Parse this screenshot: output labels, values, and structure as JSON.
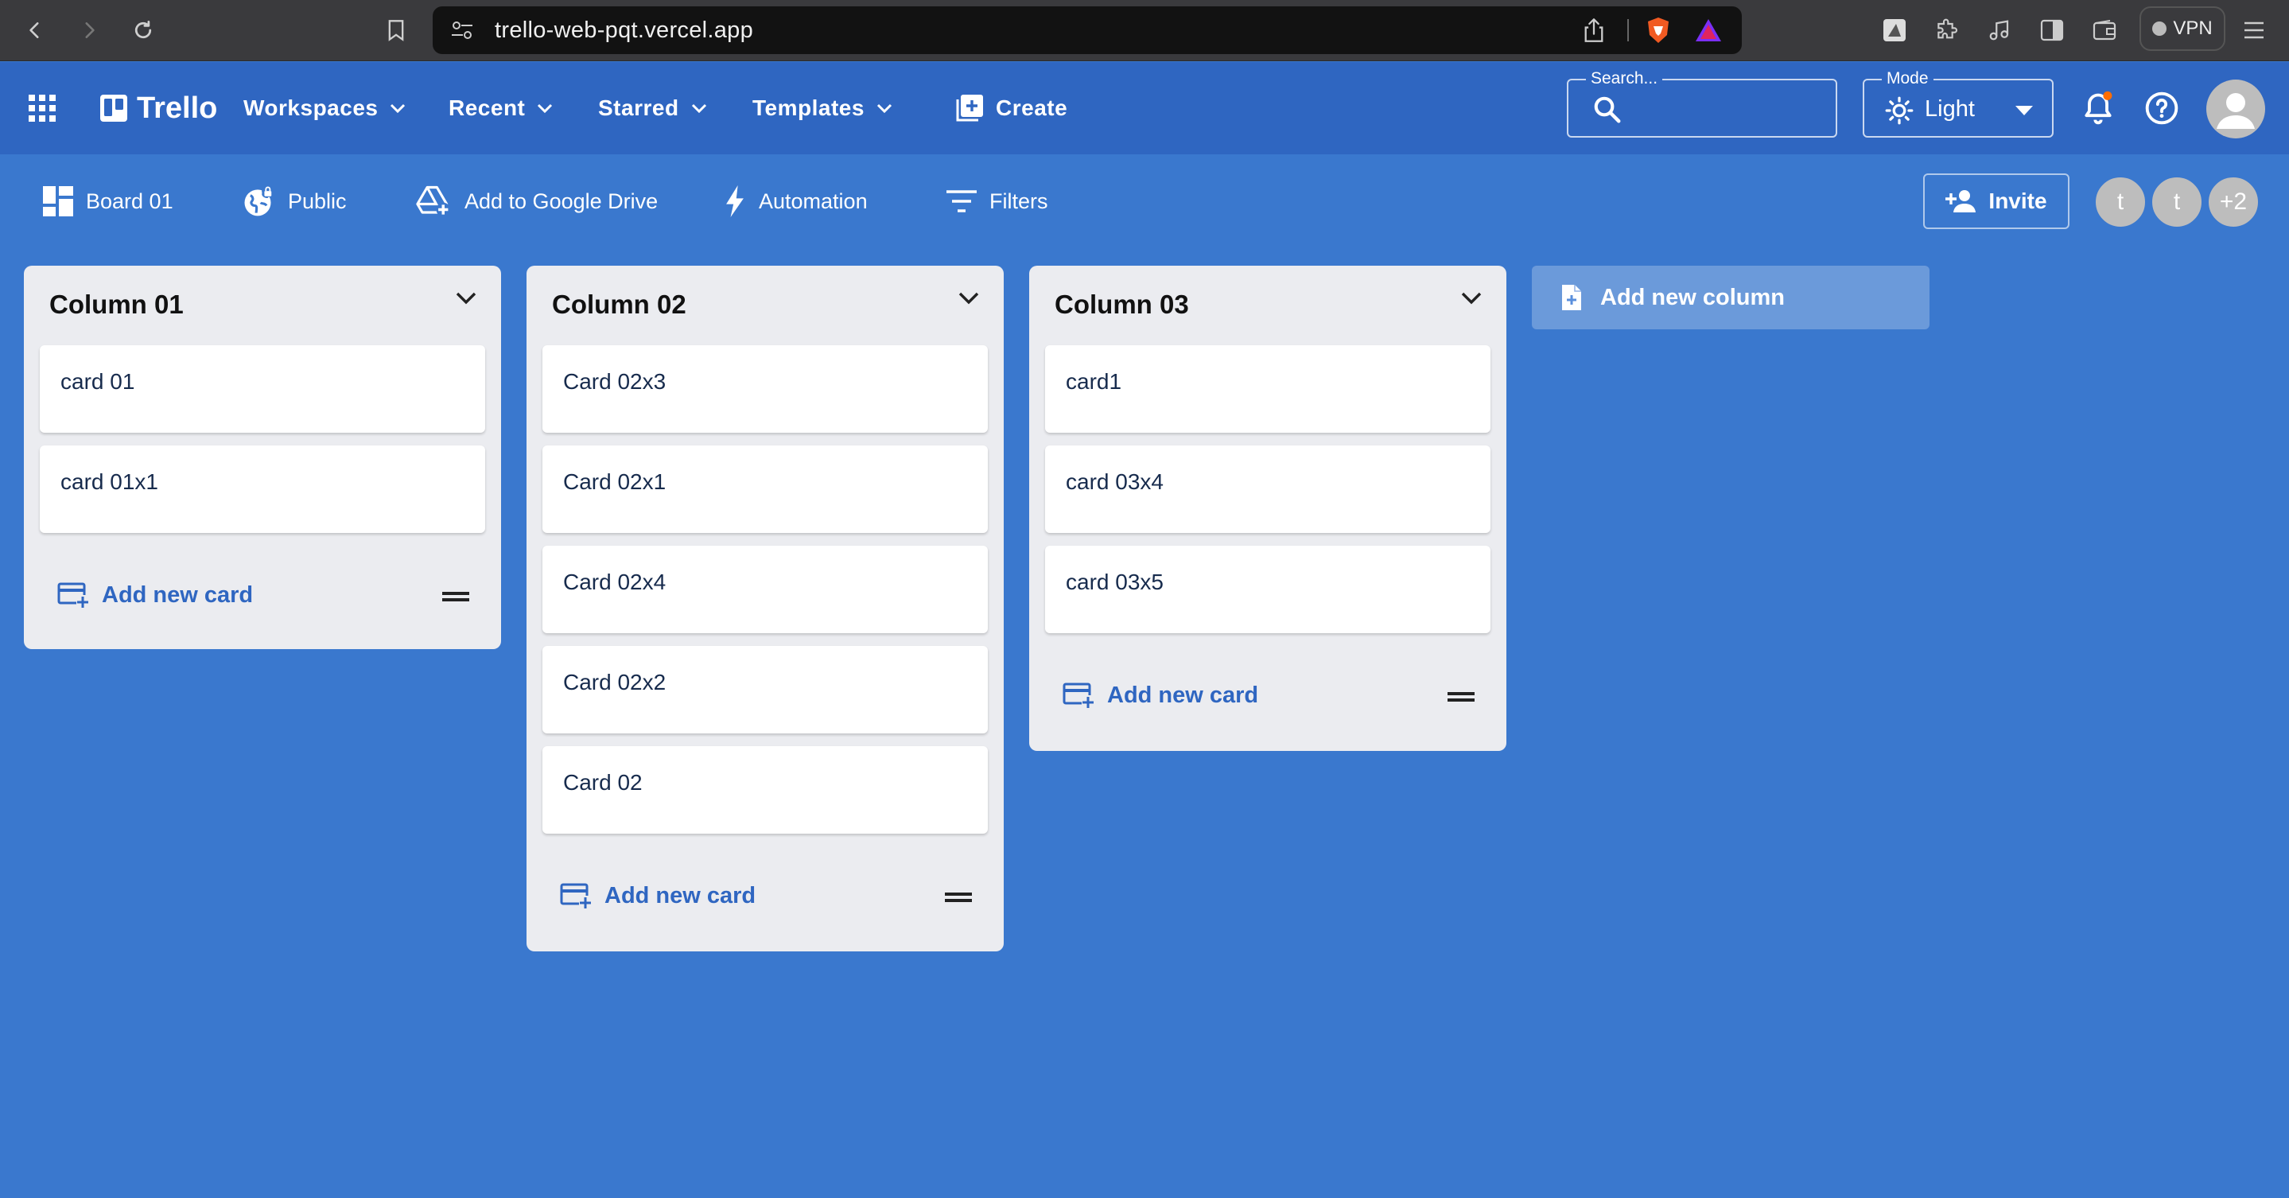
{
  "browser": {
    "url": "trello-web-pqt.vercel.app",
    "vpn_label": "VPN"
  },
  "header": {
    "logo": "Trello",
    "nav": [
      {
        "label": "Workspaces"
      },
      {
        "label": "Recent"
      },
      {
        "label": "Starred"
      },
      {
        "label": "Templates"
      }
    ],
    "create_label": "Create",
    "search": {
      "label": "Search...",
      "value": ""
    },
    "mode": {
      "label": "Mode",
      "value": "Light"
    },
    "colors": {
      "primary": "#2f66c1",
      "board": "#3a78ce",
      "notification_dot": "#ff6d00"
    }
  },
  "boardbar": {
    "board_name": "Board 01",
    "visibility": "Public",
    "drive": "Add to Google Drive",
    "automation": "Automation",
    "filters": "Filters",
    "invite": "Invite",
    "avatars": [
      "t",
      "t",
      "+2"
    ]
  },
  "columns": [
    {
      "title": "Column 01",
      "cards": [
        "card 01",
        "card 01x1"
      ],
      "add_label": "Add new card"
    },
    {
      "title": "Column 02",
      "cards": [
        "Card 02x3",
        "Card 02x1",
        "Card 02x4",
        "Card 02x2",
        "Card 02"
      ],
      "add_label": "Add new card"
    },
    {
      "title": "Column 03",
      "cards": [
        "card1",
        "card 03x4",
        "card 03x5"
      ],
      "add_label": "Add new card"
    }
  ],
  "add_column_label": "Add new column"
}
